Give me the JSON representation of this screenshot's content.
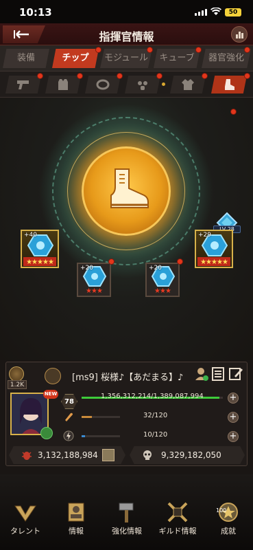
{
  "status": {
    "time": "10:13",
    "battery": "50"
  },
  "header": {
    "title": "指揮官情報"
  },
  "tabs": [
    {
      "label": "装備",
      "active": false
    },
    {
      "label": "チップ",
      "active": true
    },
    {
      "label": "モジュール",
      "active": false
    },
    {
      "label": "キューブ",
      "active": false
    },
    {
      "label": "器官強化",
      "active": false
    }
  ],
  "equipment_tabs": [
    {
      "icon": "pistol-icon"
    },
    {
      "icon": "armor-vest-icon"
    },
    {
      "icon": "belt-icon"
    },
    {
      "icon": "gas-mask-icon"
    },
    {
      "icon": "jacket-icon"
    },
    {
      "icon": "boot-icon",
      "active": true
    }
  ],
  "stage": {
    "center_icon": "boot-icon",
    "level_badge": "LV 28",
    "chips": [
      {
        "level": "+40",
        "stars": "★★★★★"
      },
      {
        "level": "+29",
        "stars": "★★★★★"
      },
      {
        "level": "+20",
        "stars": "★★★"
      },
      {
        "level": "+20",
        "stars": "★★★"
      }
    ]
  },
  "profile": {
    "medal_value": "1.2K",
    "name": "[ms9]  桜様♪【あだまる】♪",
    "new_badge": "NEW",
    "level": "78",
    "stats": [
      {
        "text": "1,356,312,214/1,389,087,994",
        "fill": 0.976,
        "color": "#3ecb3a"
      },
      {
        "text": "32/120",
        "fill": 0.267,
        "color": "#c98a3a"
      },
      {
        "text": "10/120",
        "fill": 0.083,
        "color": "#3a8ad0"
      }
    ],
    "resources": [
      {
        "icon": "bug-icon",
        "value": "3,132,188,984"
      },
      {
        "icon": "skull-icon",
        "value": "9,329,182,050"
      }
    ]
  },
  "nav": [
    {
      "label": "タレント",
      "icon": "talent-icon"
    },
    {
      "label": "情報",
      "icon": "info-icon"
    },
    {
      "label": "強化情報",
      "icon": "hammer-icon"
    },
    {
      "label": "ギルド情報",
      "icon": "guild-icon"
    },
    {
      "label": "成就",
      "icon": "achievement-icon",
      "badge": "100"
    }
  ]
}
